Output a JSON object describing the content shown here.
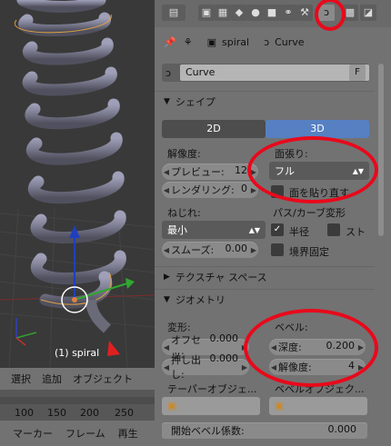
{
  "viewport": {
    "object_label": "(1) spiral",
    "menu": [
      "選択",
      "追加",
      "オブジェクト"
    ]
  },
  "timeline": {
    "ticks": [
      "100",
      "150",
      "200",
      "250"
    ],
    "menu": [
      "マーカー",
      "フレーム",
      "再生"
    ]
  },
  "properties": {
    "breadcrumb": {
      "object": "spiral",
      "data": "Curve"
    },
    "datablock": {
      "name": "Curve",
      "fake_user": "F"
    },
    "shape_section": "シェイプ",
    "dim_2d": "2D",
    "dim_3d": "3D",
    "resolution_label": "解像度:",
    "preview_label": "プレビュー:",
    "preview_value": "12",
    "render_label": "レンダリング:",
    "render_value": "0",
    "fill_label": "面張り:",
    "fill_value": "フル",
    "fill_deform_label": "面を貼り直す",
    "twist_label": "ねじれ:",
    "twist_value": "最小",
    "smooth_label": "スムーズ:",
    "smooth_value": "0.00",
    "path_deform_label": "パス/カーブ変形",
    "radius_label": "半径",
    "stretch_label": "スト",
    "bounds_label": "境界固定",
    "texture_section": "テクスチャ スペース",
    "geometry_section": "ジオメトリ",
    "modification_label": "変形:",
    "offset_label": "オフセッ:",
    "offset_value": "0.000",
    "extrude_label": "押し出し:",
    "extrude_value": "0.000",
    "taper_label": "テーパーオブジェ...",
    "bevel_label": "ベベル:",
    "depth_label": "深度:",
    "depth_value": "0.200",
    "bevel_res_label": "解像度:",
    "bevel_res_value": "4",
    "bevel_obj_label": "ベベルオブジェク...",
    "bevel_start_label": "開始ベベル係数:",
    "bevel_start_value": "0.000"
  },
  "colors": {
    "accent": "#5680c2",
    "highlight": "#e8091b"
  }
}
